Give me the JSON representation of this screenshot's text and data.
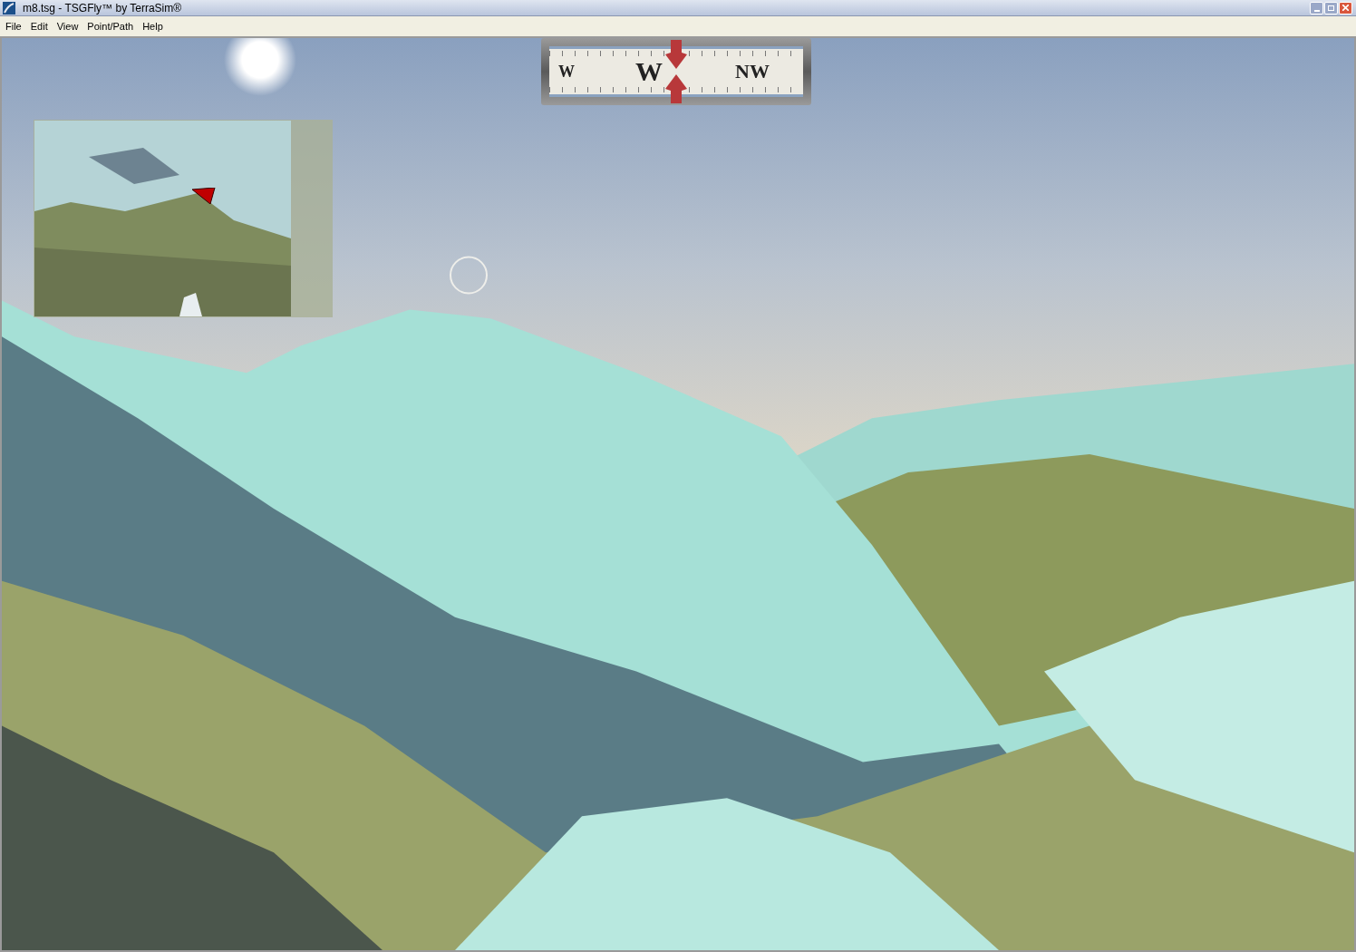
{
  "window": {
    "title": "m8.tsg - TSGFly™ by TerraSim®"
  },
  "menu": [
    {
      "label": "File"
    },
    {
      "label": "Edit"
    },
    {
      "label": "View"
    },
    {
      "label": "Point/Path"
    },
    {
      "label": "Help"
    }
  ],
  "compass": {
    "labels": [
      "W",
      "W",
      "NW"
    ]
  }
}
